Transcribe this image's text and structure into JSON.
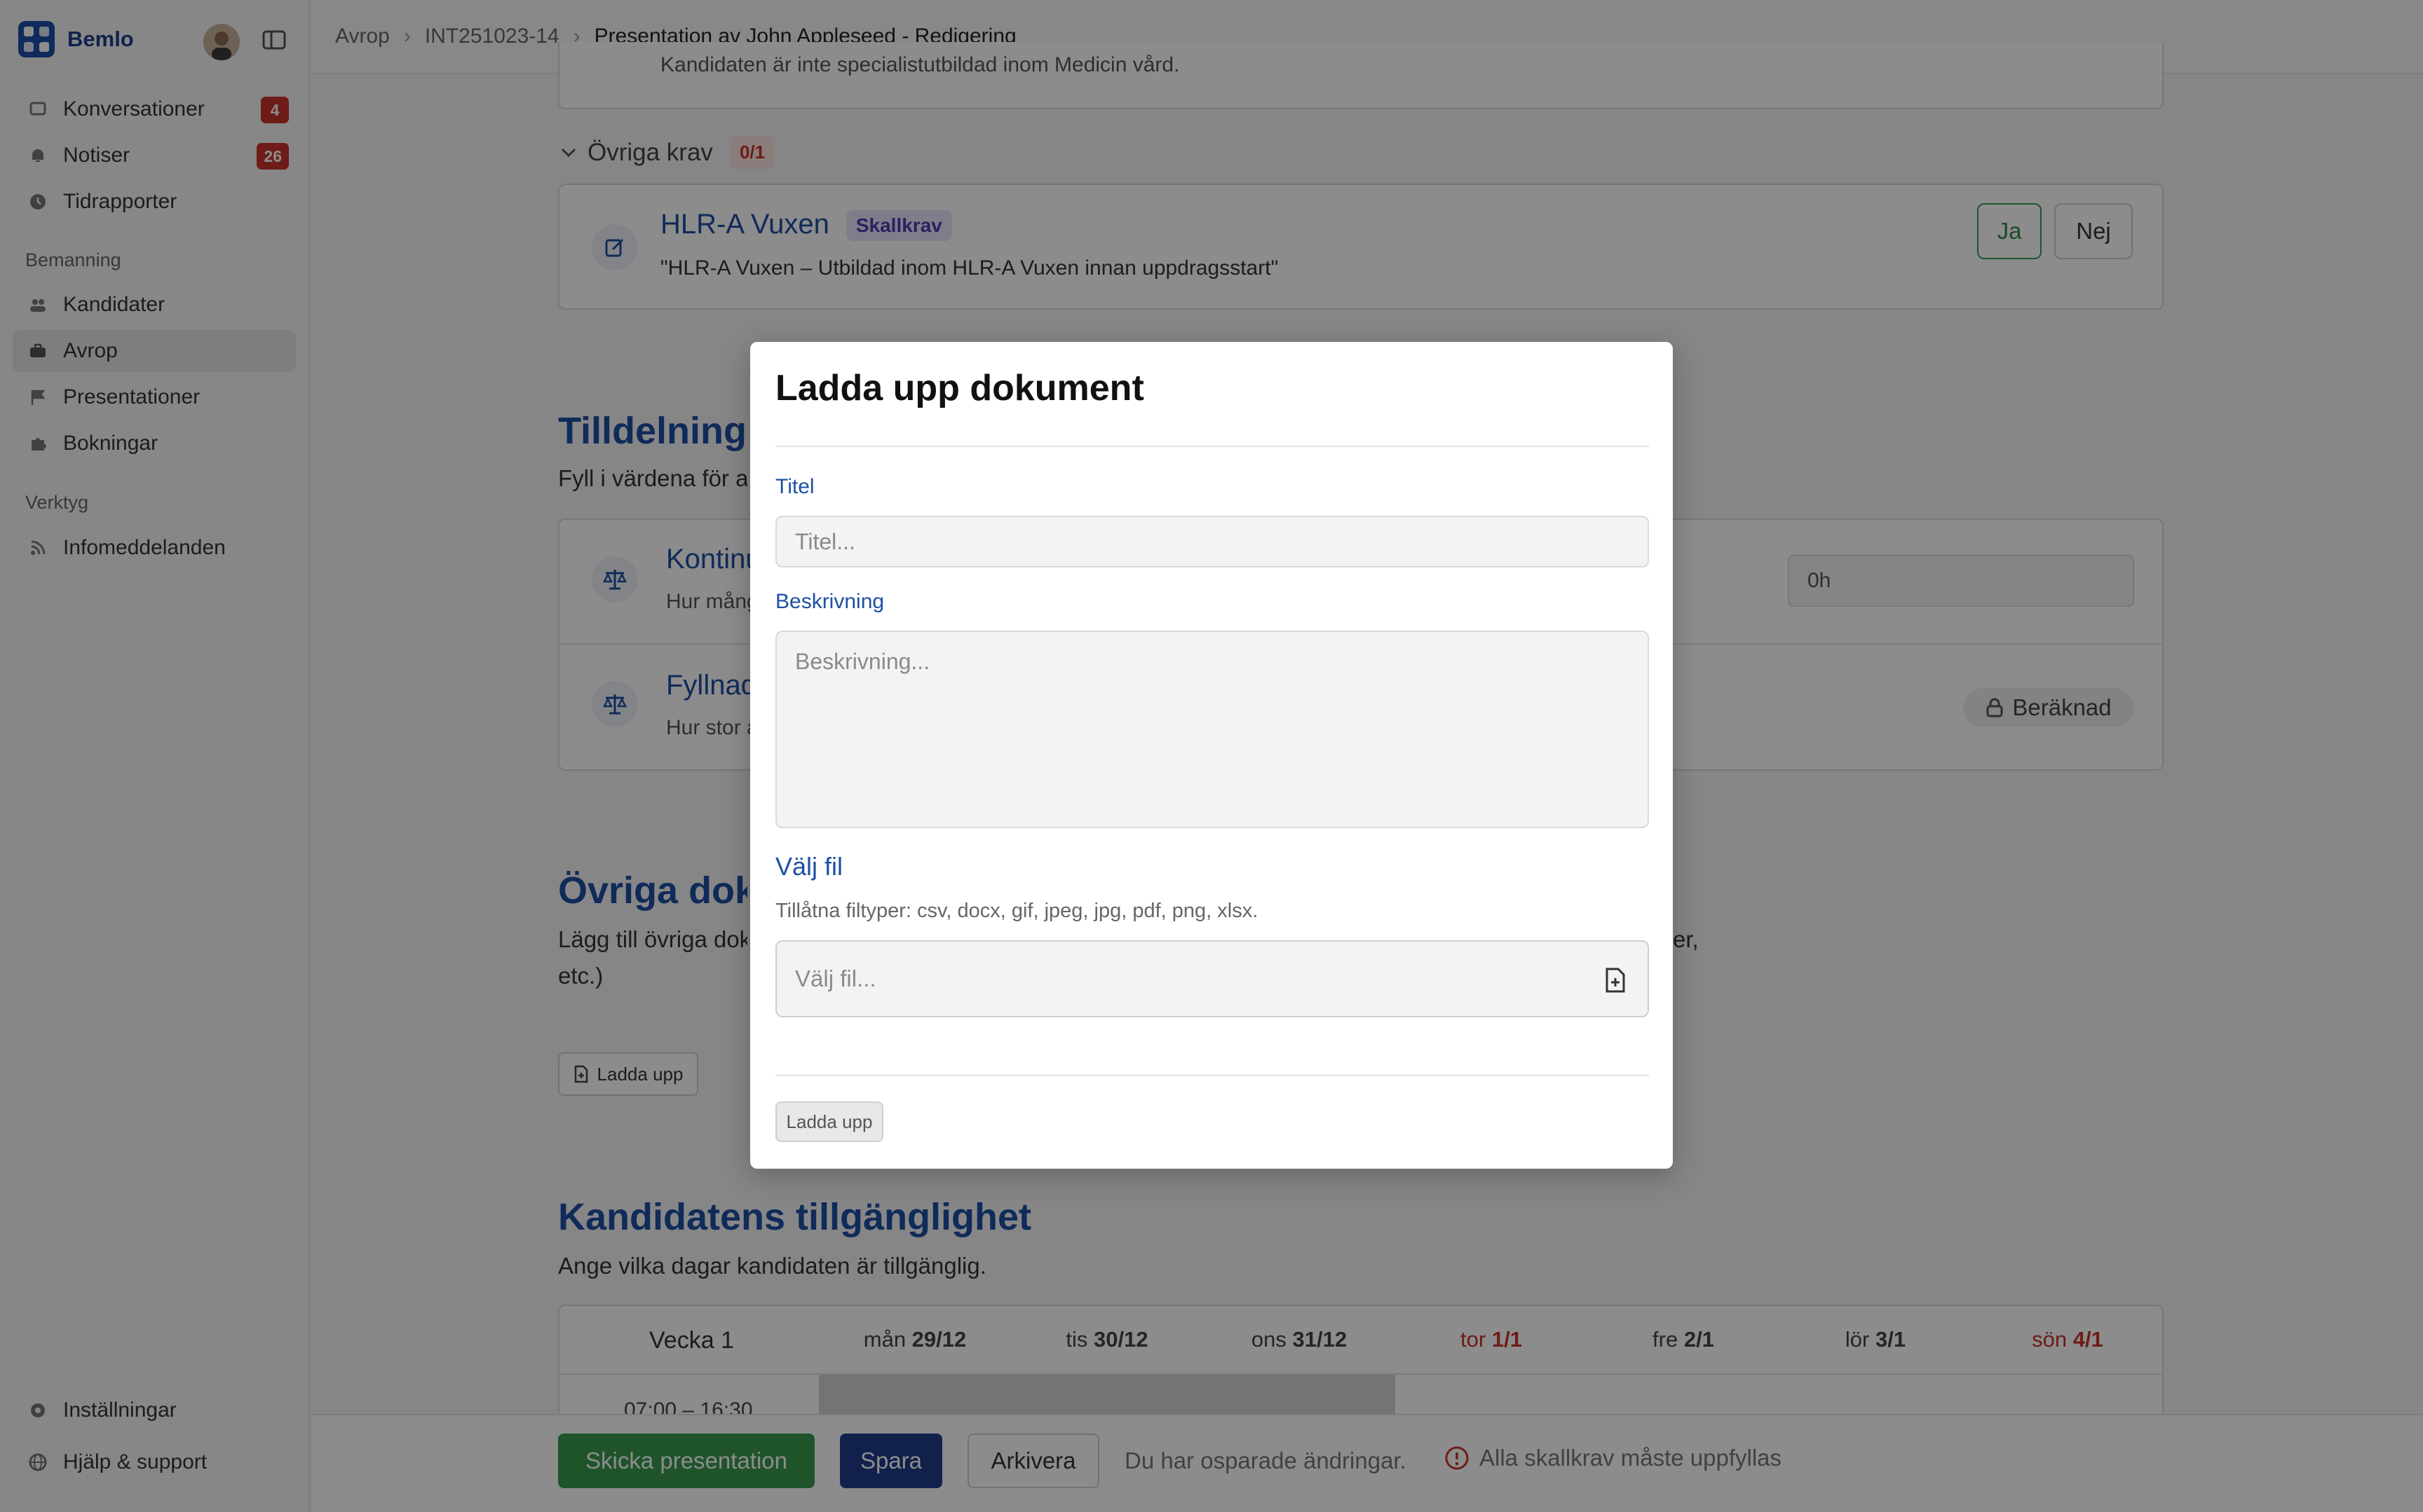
{
  "app": {
    "name": "Bemlo"
  },
  "sidebar": {
    "items_top": [
      {
        "label": "Konversationer",
        "badge": "4",
        "icon": "chat-icon"
      },
      {
        "label": "Notiser",
        "badge": "26",
        "icon": "bell-icon"
      },
      {
        "label": "Tidrapporter",
        "icon": "clock-icon"
      }
    ],
    "section_bemanning": "Bemanning",
    "items_bemanning": [
      {
        "label": "Kandidater",
        "icon": "users-icon"
      },
      {
        "label": "Avrop",
        "icon": "briefcase-icon"
      },
      {
        "label": "Presentationer",
        "icon": "flag-icon"
      },
      {
        "label": "Bokningar",
        "icon": "puzzle-icon"
      }
    ],
    "section_verktyg": "Verktyg",
    "items_verktyg": [
      {
        "label": "Infomeddelanden",
        "icon": "rss-icon"
      }
    ],
    "bottom_items": [
      {
        "label": "Inställningar",
        "icon": "gear-icon"
      },
      {
        "label": "Hjälp & support",
        "icon": "globe-icon"
      }
    ]
  },
  "breadcrumb": {
    "first": "Avrop",
    "second": "INT251023-14",
    "current": "Presentation av John Appleseed - Redigering"
  },
  "main": {
    "top_card_partial_text": "Kandidaten är inte specialistutbildad inom Medicin vård.",
    "ovriga_krav": {
      "title": "Övriga krav",
      "count": "0/1"
    },
    "hlr_card": {
      "title": "HLR-A Vuxen",
      "tag": "Skallkrav",
      "description": "\"HLR-A Vuxen – Utbildad inom HLR-A Vuxen innan uppdragsstart\"",
      "yes": "Ja",
      "no": "Nej"
    },
    "tilldelning": {
      "title": "Tilldelningsgrund",
      "subtitle": "Fyll i värdena för att beräkna tilldelningsgrund.",
      "row1": {
        "title": "Kontinuitet",
        "sub": "Hur många timmar har kandidaten arbetat hos kunden?",
        "value": "0h"
      },
      "row2": {
        "title": "Fyllnadsgrad",
        "sub": "Hur stor andel av passen kan kandidaten arbeta?",
        "status": "Beräknad"
      }
    },
    "ovriga_dok": {
      "title": "Övriga dokument",
      "line1": "Lägg till övriga dokument som kan vara relevanta för presentationen (till exempel CV, intyg, referenser,",
      "line2": "etc.)",
      "upload": "Ladda upp"
    },
    "tillganglighet": {
      "title": "Kandidatens tillgänglighet",
      "subtitle": "Ange vilka dagar kandidaten är tillgänglig.",
      "week": "Vecka 1",
      "days": [
        {
          "name": "mån",
          "date": "29/12",
          "holiday": false
        },
        {
          "name": "tis",
          "date": "30/12",
          "holiday": false
        },
        {
          "name": "ons",
          "date": "31/12",
          "holiday": false
        },
        {
          "name": "tor",
          "date": "1/1",
          "holiday": true
        },
        {
          "name": "fre",
          "date": "2/1",
          "holiday": false
        },
        {
          "name": "lör",
          "date": "3/1",
          "holiday": false
        },
        {
          "name": "sön",
          "date": "4/1",
          "holiday": true
        }
      ],
      "first_slot": "07:00 – 16:30"
    }
  },
  "bottom": {
    "send": "Skicka presentation",
    "save": "Spara",
    "archive": "Arkivera",
    "unsaved": "Du har osparade ändringar.",
    "warning": "Alla skallkrav måste uppfyllas"
  },
  "modal": {
    "title": "Ladda upp dokument",
    "title_label": "Titel",
    "title_placeholder": "Titel...",
    "desc_label": "Beskrivning",
    "desc_placeholder": "Beskrivning...",
    "file_title": "Välj fil",
    "file_hint": "Tillåtna filtyper: csv, docx, gif, jpeg, jpg, pdf, png, xlsx.",
    "file_placeholder": "Välj fil...",
    "upload": "Ladda upp"
  },
  "colors": {
    "accent": "#1e4fa3",
    "green": "#3a9a4f",
    "danger": "#c9332b"
  }
}
